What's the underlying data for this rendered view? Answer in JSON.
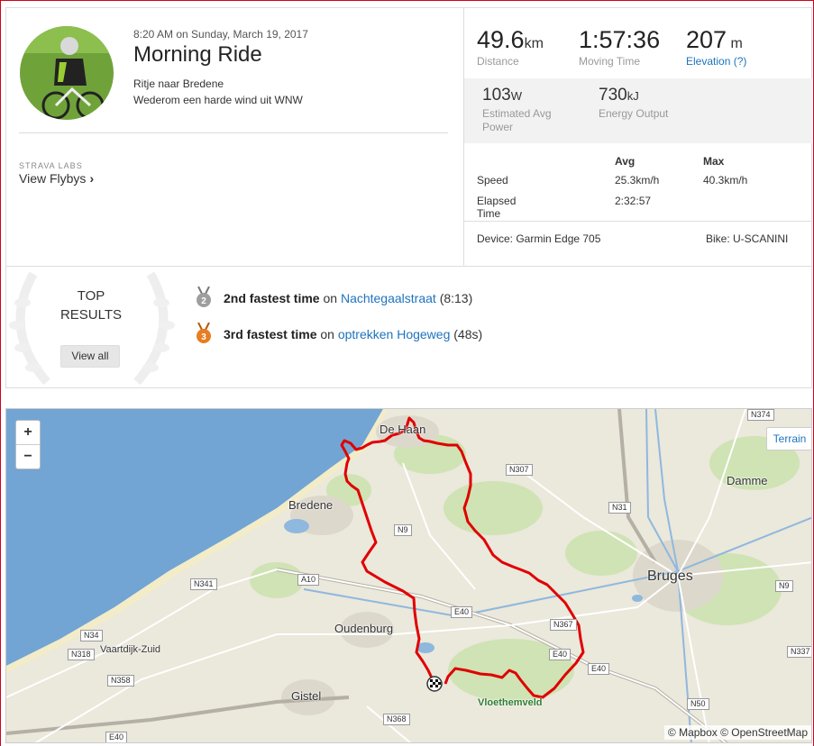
{
  "activity": {
    "time": "8:20 AM on Sunday, March 19, 2017",
    "title": "Morning Ride",
    "description_lines": [
      "Ritje naar Bredene",
      "Wederom een harde wind uit WNW"
    ],
    "labs_label": "STRAVA LABS",
    "flyby_label": "View Flybys"
  },
  "stats": {
    "distance": {
      "value": "49.6",
      "unit": "km",
      "label": "Distance"
    },
    "moving_time": {
      "value": "1:57:36",
      "label": "Moving Time"
    },
    "elevation": {
      "value": "207",
      "unit": "m",
      "label": "Elevation (?)"
    },
    "power": {
      "value": "103",
      "unit": "W",
      "label": "Estimated Avg Power"
    },
    "energy": {
      "value": "730",
      "unit": "kJ",
      "label": "Energy Output"
    }
  },
  "table": {
    "avg_header": "Avg",
    "max_header": "Max",
    "rows": [
      {
        "label": "Speed",
        "avg": "25.3km/h",
        "max": "40.3km/h"
      },
      {
        "label": "Elapsed Time",
        "avg": "2:32:57",
        "max": ""
      }
    ]
  },
  "device": "Device: Garmin Edge 705",
  "bike": "Bike: U-SCANINI",
  "results": {
    "title_line1": "TOP",
    "title_line2": "RESULTS",
    "view_all": "View all",
    "achievements": [
      {
        "rank": "2",
        "text": "2nd fastest time",
        "on": "on",
        "segment": "Nachtegaalstraat",
        "time": "(8:13)",
        "medal_color": "#9e9e9e"
      },
      {
        "rank": "3",
        "text": "3rd fastest time",
        "on": "on",
        "segment": "optrekken Hogeweg",
        "time": "(48s)",
        "medal_color": "#e67e22"
      }
    ]
  },
  "map": {
    "zoom_in": "+",
    "zoom_out": "−",
    "terrain": "Terrain",
    "attribution": "© Mapbox © OpenStreetMap",
    "places": {
      "de_haan": "De Haan",
      "bredene": "Bredene",
      "damme": "Damme",
      "bruges": "Bruges",
      "oudenburg": "Oudenburg",
      "vaartdijk": "Vaartdijk-Zuid",
      "gistel": "Gistel",
      "vloethemveld": "Vloethemveld"
    },
    "roads": {
      "n374": "N374",
      "n307": "N307",
      "n31": "N31",
      "n9a": "N9",
      "n9b": "N9",
      "a10": "A10",
      "n341": "N341",
      "e40a": "E40",
      "n367": "N367",
      "e40b": "E40",
      "e40c": "E40",
      "n34": "N34",
      "n318": "N318",
      "n358": "N358",
      "n337": "N337",
      "n50": "N50",
      "n368": "N368",
      "e40d": "E40"
    },
    "route_color": "#e00000"
  }
}
